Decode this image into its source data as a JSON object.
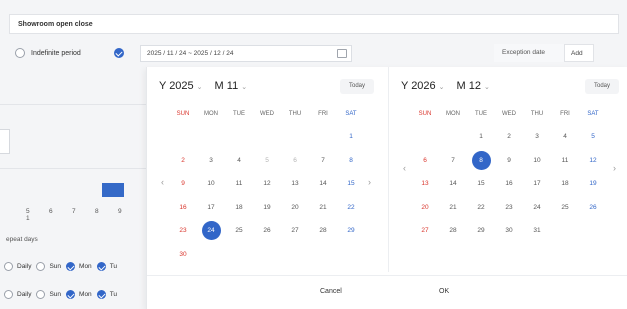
{
  "header": {
    "title": "Showroom open close"
  },
  "period": {
    "indefinite_label": "Indefinite period",
    "range_value": "2025 / 11 / 24 ~ 2025 / 12 / 24",
    "exception_label": "Exception date",
    "add_label": "Add"
  },
  "left_pane": {
    "numbers": [
      "5",
      "6",
      "7",
      "8",
      "9",
      "1"
    ],
    "repeat_label": "epeat days",
    "rows": [
      {
        "daily": "Daily",
        "sun": "Sun",
        "mon": "Mon",
        "tu": "Tu"
      },
      {
        "daily": "Daily",
        "sun": "Sun",
        "mon": "Mon",
        "tu": "Tu"
      }
    ]
  },
  "dow": [
    "SUN",
    "MON",
    "TUE",
    "WED",
    "THU",
    "FRI",
    "SAT"
  ],
  "cal_left": {
    "year": "Y 2025",
    "month": "M 11",
    "today": "Today"
  },
  "cal_right": {
    "year": "Y 2026",
    "month": "M 12",
    "today": "Today"
  },
  "footer": {
    "cancel": "Cancel",
    "ok": "OK"
  },
  "colors": {
    "accent": "#3266c8",
    "sunday": "#d9342b"
  },
  "left_weeks": [
    [
      [
        "",
        0
      ],
      [
        "",
        0
      ],
      [
        "",
        0
      ],
      [
        "",
        0
      ],
      [
        "",
        0
      ],
      [
        "",
        0
      ],
      [
        "1",
        0
      ]
    ],
    [
      [
        "2",
        0
      ],
      [
        "3",
        0
      ],
      [
        "4",
        0
      ],
      [
        "5",
        1
      ],
      [
        "6",
        1
      ],
      [
        "7",
        0
      ],
      [
        "8",
        0
      ]
    ],
    [
      [
        "9",
        0
      ],
      [
        "10",
        0
      ],
      [
        "11",
        0
      ],
      [
        "12",
        0
      ],
      [
        "13",
        0
      ],
      [
        "14",
        0
      ],
      [
        "15",
        0
      ]
    ],
    [
      [
        "16",
        0
      ],
      [
        "17",
        0
      ],
      [
        "18",
        0
      ],
      [
        "19",
        0
      ],
      [
        "20",
        0
      ],
      [
        "21",
        0
      ],
      [
        "22",
        0
      ]
    ],
    [
      [
        "23",
        0
      ],
      [
        "24",
        2
      ],
      [
        "25",
        0
      ],
      [
        "26",
        0
      ],
      [
        "27",
        0
      ],
      [
        "28",
        0
      ],
      [
        "29",
        0
      ]
    ],
    [
      [
        "30",
        0
      ],
      [
        "",
        0
      ],
      [
        "",
        0
      ],
      [
        "",
        0
      ],
      [
        "",
        0
      ],
      [
        "",
        0
      ],
      [
        "",
        0
      ]
    ]
  ],
  "right_weeks": [
    [
      [
        "",
        0
      ],
      [
        "",
        0
      ],
      [
        "1",
        0
      ],
      [
        "2",
        0
      ],
      [
        "3",
        0
      ],
      [
        "4",
        0
      ],
      [
        "5",
        0
      ]
    ],
    [
      [
        "6",
        0
      ],
      [
        "7",
        0
      ],
      [
        "8",
        2
      ],
      [
        "9",
        0
      ],
      [
        "10",
        0
      ],
      [
        "11",
        0
      ],
      [
        "12",
        0
      ]
    ],
    [
      [
        "13",
        0
      ],
      [
        "14",
        0
      ],
      [
        "15",
        0
      ],
      [
        "16",
        0
      ],
      [
        "17",
        0
      ],
      [
        "18",
        0
      ],
      [
        "19",
        0
      ]
    ],
    [
      [
        "20",
        0
      ],
      [
        "21",
        0
      ],
      [
        "22",
        0
      ],
      [
        "23",
        0
      ],
      [
        "24",
        0
      ],
      [
        "25",
        0
      ],
      [
        "26",
        0
      ]
    ],
    [
      [
        "27",
        0
      ],
      [
        "28",
        0
      ],
      [
        "29",
        0
      ],
      [
        "30",
        0
      ],
      [
        "31",
        0
      ],
      [
        "",
        0
      ],
      [
        "",
        0
      ]
    ]
  ]
}
